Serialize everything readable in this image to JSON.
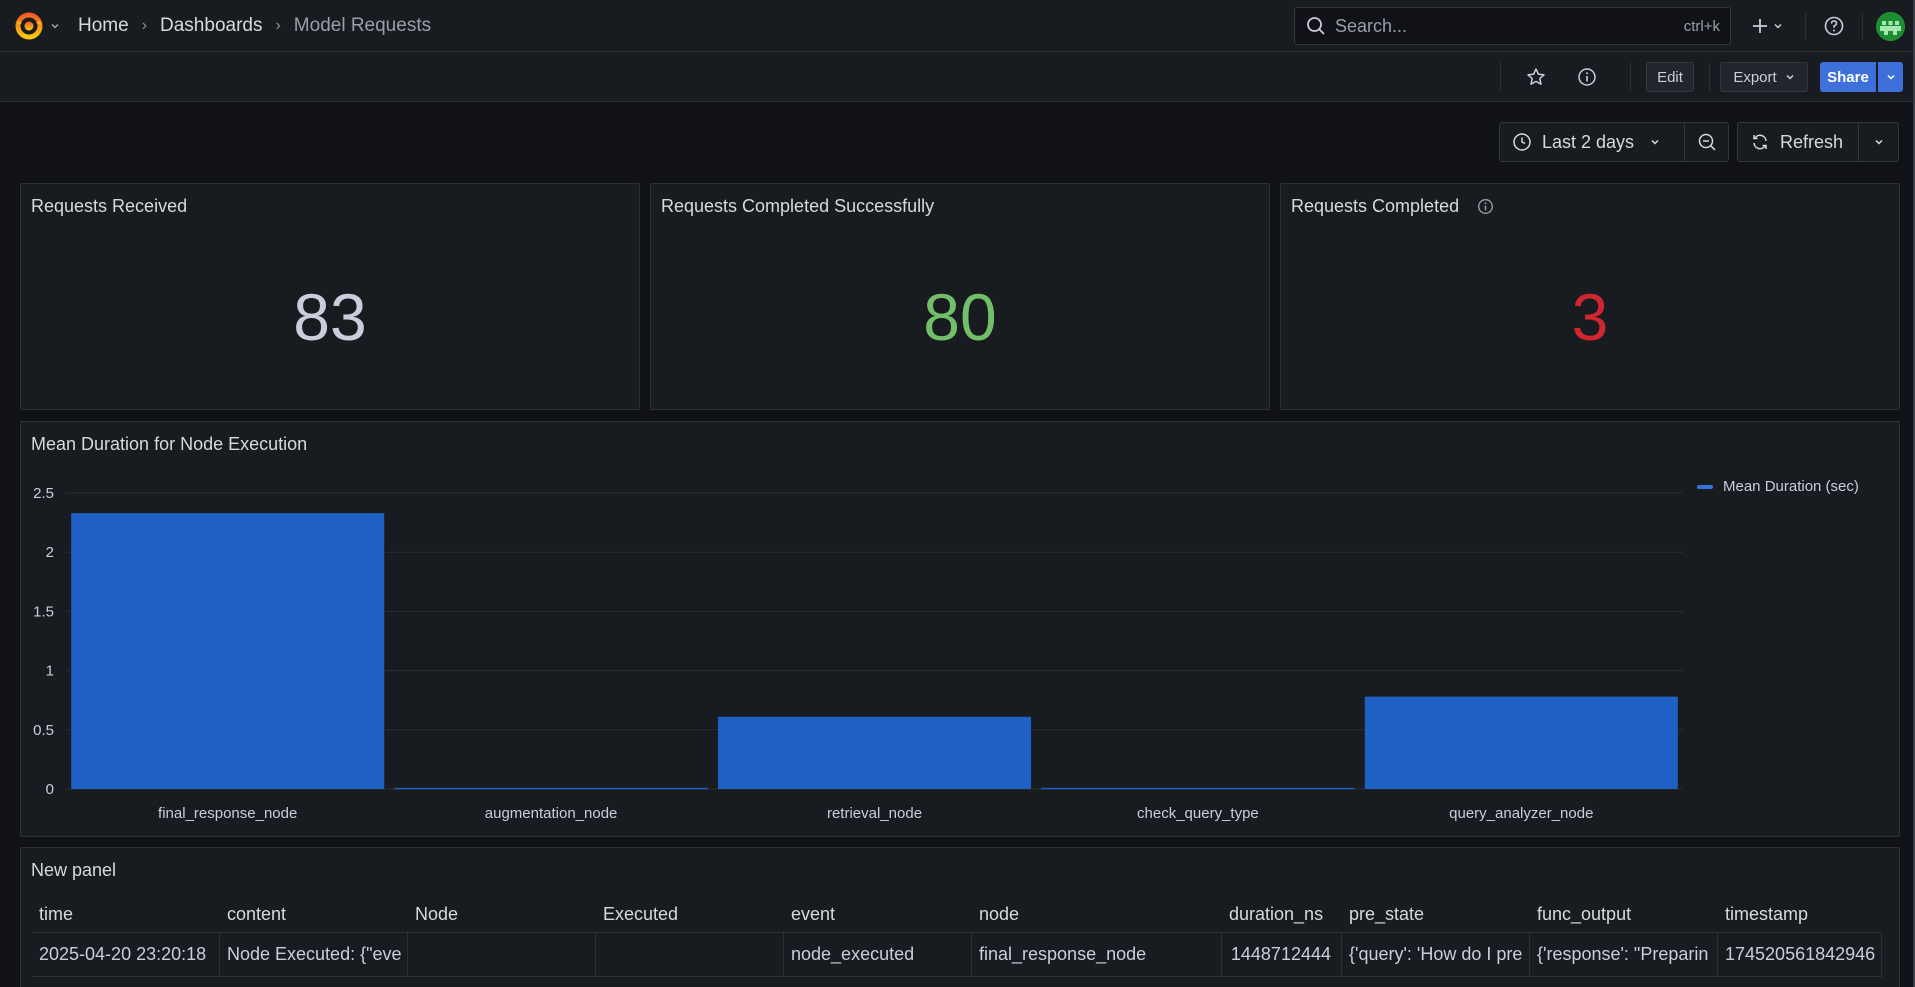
{
  "breadcrumb": {
    "home": "Home",
    "dashboards": "Dashboards",
    "current": "Model Requests"
  },
  "search": {
    "placeholder": "Search...",
    "shortcut": "ctrl+k"
  },
  "toolbar": {
    "edit_label": "Edit",
    "export_label": "Export",
    "share_label": "Share"
  },
  "time_controls": {
    "range_label": "Last 2 days",
    "refresh_label": "Refresh"
  },
  "stats": [
    {
      "title": "Requests Received",
      "value": "83",
      "color": "#ccccdc"
    },
    {
      "title": "Requests Completed Successfully",
      "value": "80",
      "color": "#73bf69"
    },
    {
      "title": "Requests Completed",
      "value": "3",
      "color": "#d0262f"
    }
  ],
  "chart_panel": {
    "title": "Mean Duration for Node Execution"
  },
  "chart_data": {
    "type": "bar",
    "title": "Mean Duration for Node Execution",
    "categories": [
      "final_response_node",
      "augmentation_node",
      "retrieval_node",
      "check_query_type",
      "query_analyzer_node"
    ],
    "series": [
      {
        "name": "Mean Duration (sec)",
        "values": [
          2.33,
          0.01,
          0.61,
          0.01,
          0.78
        ],
        "color": "#1f60c4"
      }
    ],
    "y_ticks": [
      "0",
      "0.5",
      "1",
      "1.5",
      "2",
      "2.5"
    ],
    "ylim": [
      0,
      2.5
    ],
    "grid": true,
    "legend_position": "top-right"
  },
  "table_panel": {
    "title": "New panel",
    "columns": [
      "time",
      "content",
      "Node",
      "Executed",
      "event",
      "node",
      "duration_ns",
      "pre_state",
      "func_output",
      "timestamp"
    ],
    "rows": [
      [
        "2025-04-20 23:20:18",
        "Node Executed: {\"eve",
        "",
        "",
        "node_executed",
        "final_response_node",
        "1448712444",
        "{'query': 'How do I pre",
        "{'response': \"Preparin",
        "174520561842946"
      ]
    ]
  }
}
